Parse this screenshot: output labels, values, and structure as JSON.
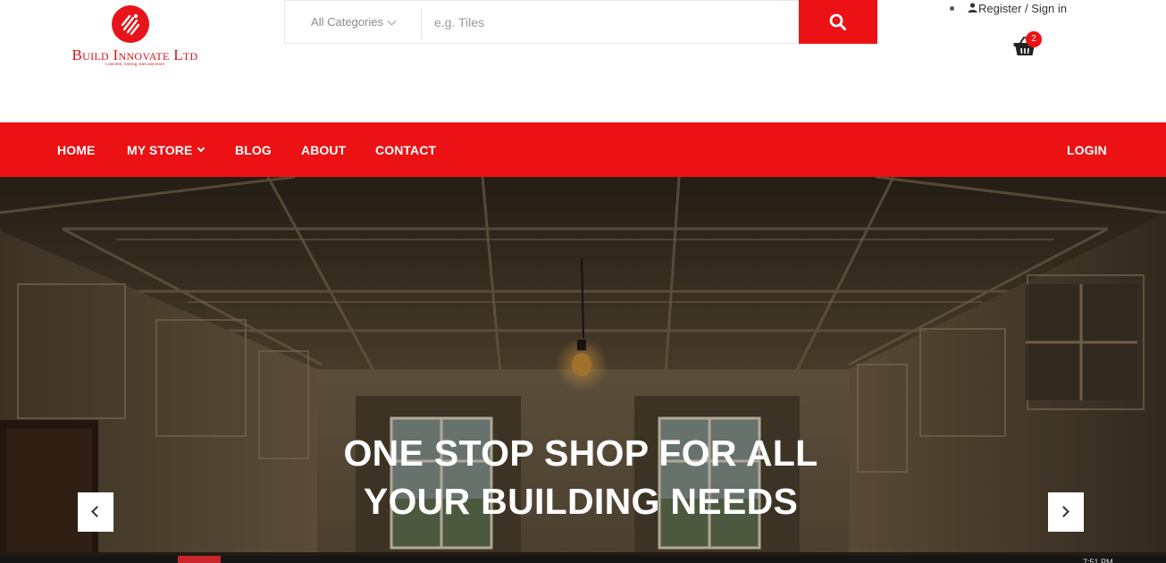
{
  "brand": {
    "name": "Build Innovate Ltd",
    "tagline": "Concrete, roofing, tiles and more"
  },
  "search": {
    "category_label": "All Categories",
    "placeholder": "e.g. Tiles",
    "value": ""
  },
  "account": {
    "register_signin": "Register / Sign in"
  },
  "cart": {
    "count": "2"
  },
  "nav": {
    "home": "HOME",
    "my_store": "MY STORE",
    "blog": "BLOG",
    "about": "ABOUT",
    "contact": "CONTACT",
    "login": "LOGIN"
  },
  "hero": {
    "title_line1": "ONE STOP SHOP FOR ALL",
    "title_line2": "YOUR BUILDING NEEDS"
  },
  "taskbar": {
    "time": "7:51 PM"
  },
  "colors": {
    "brand_red": "#ec1114",
    "white": "#ffffff"
  },
  "icons": [
    "logo-mark-icon",
    "chevron-down-icon",
    "search-icon",
    "user-icon",
    "cart-basket-icon",
    "chevron-left-icon",
    "chevron-right-icon"
  ]
}
